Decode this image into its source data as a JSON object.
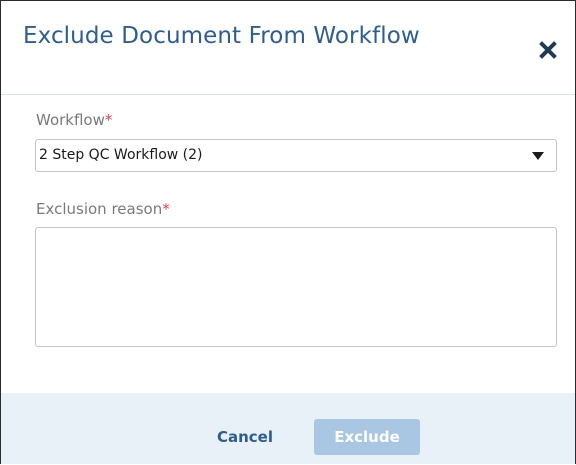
{
  "dialog": {
    "title": "Exclude Document From Workflow",
    "close_icon": "close-icon"
  },
  "workflow_field": {
    "label": "Workflow",
    "required_marker": "*",
    "selected_value": "2 Step QC Workflow (2)",
    "dropdown_icon": "caret-down-icon"
  },
  "reason_field": {
    "label": "Exclusion reason",
    "required_marker": "*",
    "value": ""
  },
  "footer": {
    "cancel_label": "Cancel",
    "exclude_label": "Exclude",
    "exclude_disabled": true
  },
  "colors": {
    "title": "#2f5e8e",
    "required": "#e0454f",
    "footer_bg": "#e8f0f8",
    "exclude_disabled_bg": "#a9c6e2"
  }
}
